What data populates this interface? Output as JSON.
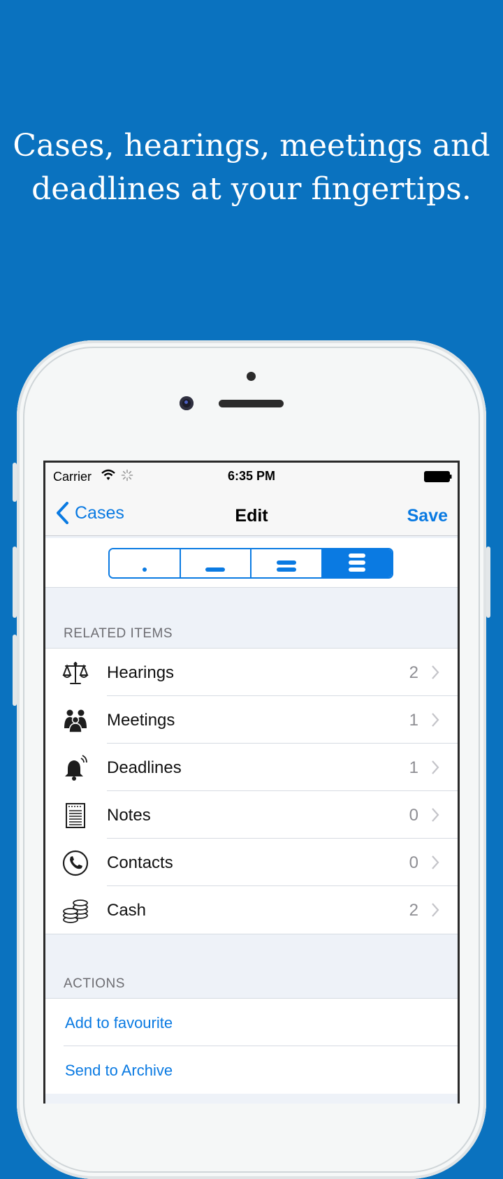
{
  "headline": {
    "line1": "Cases, hearings, meetings and",
    "line2": "deadlines at your fingertips."
  },
  "status_bar": {
    "carrier": "Carrier",
    "time": "6:35 PM"
  },
  "nav": {
    "back_label": "Cases",
    "title": "Edit",
    "save_label": "Save"
  },
  "segments": [
    {
      "icon": "priority-low-icon"
    },
    {
      "icon": "priority-medium-icon"
    },
    {
      "icon": "priority-high-icon"
    },
    {
      "icon": "priority-highest-icon",
      "selected": true
    }
  ],
  "related": {
    "header": "RELATED ITEMS",
    "items": [
      {
        "label": "Hearings",
        "count": "2",
        "icon": "scales-icon"
      },
      {
        "label": "Meetings",
        "count": "1",
        "icon": "people-icon"
      },
      {
        "label": "Deadlines",
        "count": "1",
        "icon": "bell-icon"
      },
      {
        "label": "Notes",
        "count": "0",
        "icon": "notes-icon"
      },
      {
        "label": "Contacts",
        "count": "0",
        "icon": "phone-icon"
      },
      {
        "label": "Cash",
        "count": "2",
        "icon": "coins-icon"
      }
    ]
  },
  "actions": {
    "header": "ACTIONS",
    "items": [
      {
        "label": "Add to favourite"
      },
      {
        "label": "Send to Archive"
      }
    ]
  },
  "colors": {
    "background": "#0a72bf",
    "accent": "#0a7ae2"
  }
}
